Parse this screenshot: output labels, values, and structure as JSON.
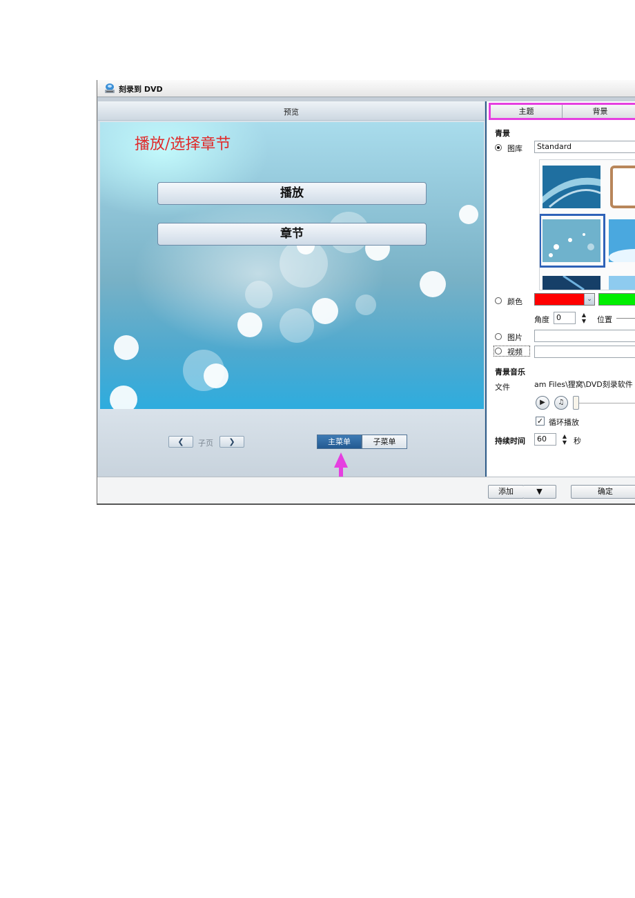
{
  "window": {
    "title": "刻录到 DVD",
    "icon": "burner-icon"
  },
  "preview": {
    "header": "预览",
    "menu_title": "播放/选择章节",
    "buttons": [
      "播放",
      "章节"
    ],
    "footer": {
      "prev_icon": "chevron-left-icon",
      "next_icon": "chevron-right-icon",
      "page_label": "子页",
      "menu_tabs": [
        {
          "label": "主菜单",
          "active": true
        },
        {
          "label": "子菜单",
          "active": false
        }
      ],
      "annotation_color": "#e53fe0"
    }
  },
  "settings": {
    "tabs": [
      "主题",
      "背景"
    ],
    "background_section": "青景",
    "library_label": "图库",
    "library_value": "Standard",
    "color_label": "颜色",
    "color_swatches": [
      "#ff0000",
      "#00ee00"
    ],
    "angle_label": "角度",
    "angle_value": "0",
    "position_label": "位置",
    "image_label": "图片",
    "video_label": "视频",
    "music_section": "青景音乐",
    "file_label": "文件",
    "file_value": "am Files\\狸窝\\DVD刻录软件",
    "loop_label": "循环播放",
    "loop_checked": true,
    "duration_label": "持续时间",
    "duration_value": "60",
    "duration_unit": "秒",
    "selected_border": "#2f62b8"
  },
  "bottom": {
    "add_label": "添加",
    "add_dropdown_icon": "caret-down-icon",
    "ok_label": "确定"
  }
}
